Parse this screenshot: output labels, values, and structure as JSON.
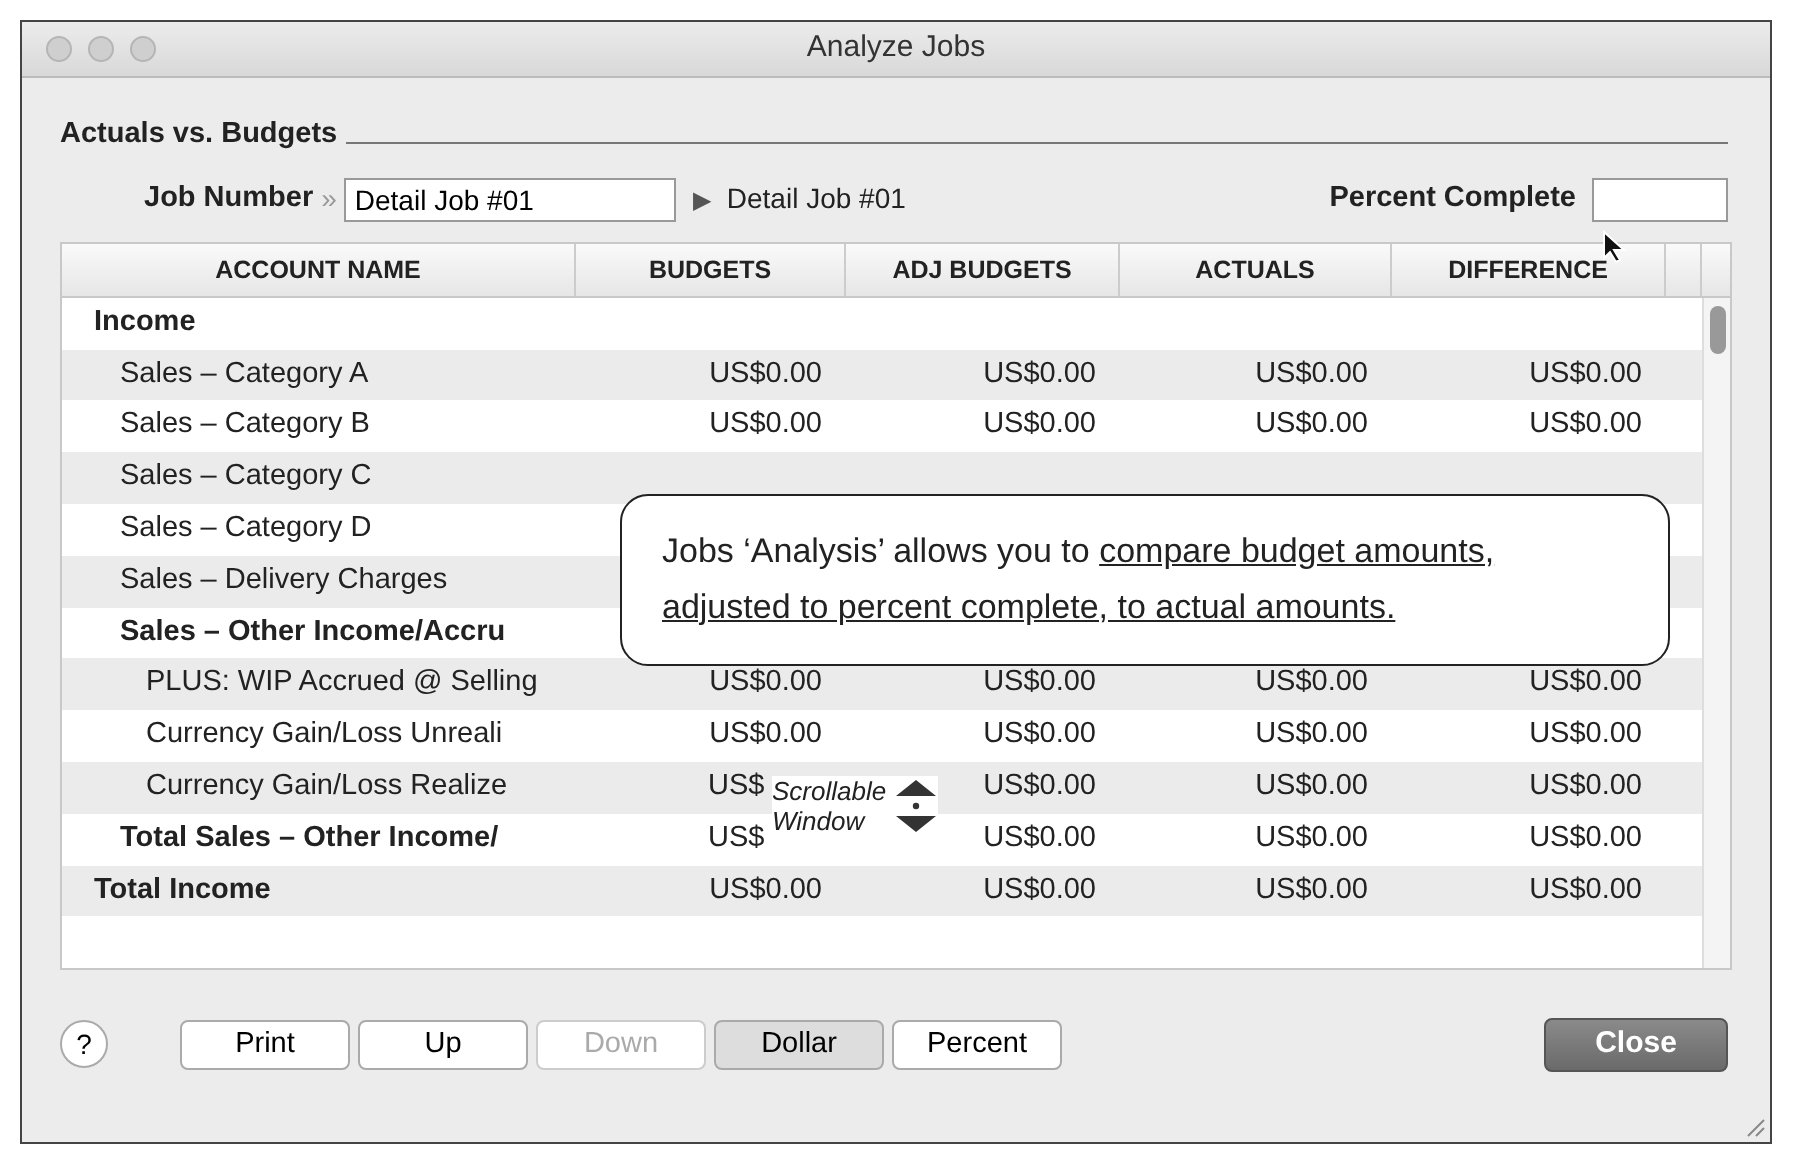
{
  "window": {
    "title": "Analyze Jobs"
  },
  "section_title": "Actuals vs. Budgets",
  "job": {
    "label": "Job Number",
    "chevron": "»",
    "value": "Detail Job #01",
    "arrow": "▶",
    "name": "Detail Job #01"
  },
  "percent_complete": {
    "label": "Percent Complete"
  },
  "table": {
    "columns": [
      "ACCOUNT NAME",
      "BUDGETS",
      "ADJ BUDGETS",
      "ACTUALS",
      "DIFFERENCE"
    ],
    "rows": [
      {
        "bold": true,
        "name": "Income",
        "children": [
          {
            "bold": false,
            "name": "Sales – Category A",
            "values": [
              "US$0.00",
              "US$0.00",
              "US$0.00",
              "US$0.00"
            ]
          },
          {
            "bold": false,
            "name": "Sales – Category B",
            "values": [
              "US$0.00",
              "US$0.00",
              "US$0.00",
              "US$0.00"
            ]
          },
          {
            "bold": false,
            "name": "Sales – Category C"
          },
          {
            "bold": false,
            "name": "Sales – Category D"
          },
          {
            "bold": false,
            "name": "Sales – Delivery Charges"
          },
          {
            "bold": true,
            "name": "Sales – Other Income/Accru",
            "children": [
              {
                "bold": false,
                "name": "PLUS: WIP Accrued @ Selling",
                "values": [
                  "US$0.00",
                  "US$0.00",
                  "US$0.00",
                  "US$0.00"
                ]
              },
              {
                "bold": false,
                "name": "Currency Gain/Loss Unreali",
                "values": [
                  "US$0.00",
                  "US$0.00",
                  "US$0.00",
                  "US$0.00"
                ]
              },
              {
                "bold": false,
                "name": "Currency Gain/Loss Realize",
                "values": [
                  "US$",
                  "US$0.00",
                  "US$0.00",
                  "US$0.00"
                ]
              }
            ]
          },
          {
            "bold": true,
            "name": "Total Sales – Other Income/",
            "values": [
              "US$",
              "US$0.00",
              "US$0.00",
              "US$0.00"
            ]
          }
        ]
      },
      {
        "bold": true,
        "name": "Total Income",
        "values": [
          "US$0.00",
          "US$0.00",
          "US$0.00",
          "US$0.00"
        ]
      }
    ]
  },
  "callout": {
    "text": "Jobs ‘Analysis’ allows you to",
    "underlined": "compare budget amounts, adjusted to percent complete, to actual amounts."
  },
  "scroll_note": {
    "line_1": "Scrollable",
    "line_2": "Window"
  },
  "help": {
    "label": "?"
  },
  "buttons": [
    {
      "label": "Print",
      "disabled": false,
      "selected": false
    },
    {
      "label": "Up",
      "disabled": false,
      "selected": false
    },
    {
      "label": "Down",
      "disabled": true,
      "selected": false
    },
    {
      "label": "Dollar",
      "disabled": false,
      "selected": true
    },
    {
      "label": "Percent",
      "disabled": false,
      "selected": false
    }
  ],
  "close": {
    "label": "Close"
  }
}
